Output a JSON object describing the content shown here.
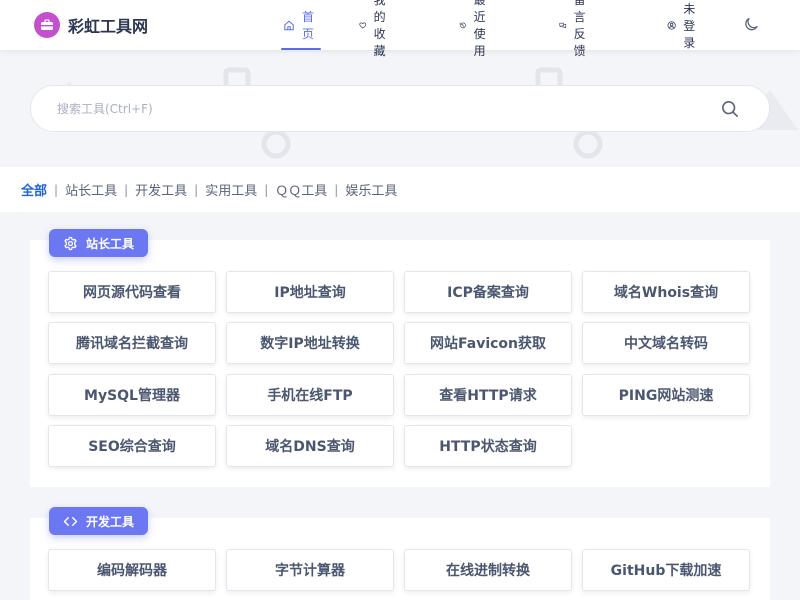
{
  "header": {
    "site_title": "彩虹工具网",
    "nav": [
      {
        "label": "首页",
        "icon": "home-icon"
      },
      {
        "label": "我的收藏",
        "icon": "heart-icon"
      },
      {
        "label": "最近使用",
        "icon": "history-icon"
      },
      {
        "label": "留言反馈",
        "icon": "chat-icon"
      },
      {
        "label": "未登录",
        "icon": "user-icon"
      }
    ],
    "theme_toggle_icon": "moon-icon"
  },
  "search": {
    "placeholder": "搜索工具(Ctrl+F)",
    "value": ""
  },
  "categories": [
    "全部",
    "站长工具",
    "开发工具",
    "实用工具",
    "ＱＱ工具",
    "娱乐工具"
  ],
  "sections": [
    {
      "title": "站长工具",
      "icon": "gear-icon",
      "tools": [
        "网页源代码查看",
        "IP地址查询",
        "ICP备案查询",
        "域名Whois查询",
        "腾讯域名拦截查询",
        "数字IP地址转换",
        "网站Favicon获取",
        "中文域名转码",
        "MySQL管理器",
        "手机在线FTP",
        "查看HTTP请求",
        "PING网站测速",
        "SEO综合查询",
        "域名DNS查询",
        "HTTP状态查询"
      ]
    },
    {
      "title": "开发工具",
      "icon": "code-icon",
      "tools": [
        "编码解码器",
        "字节计算器",
        "在线进制转换",
        "GitHub下载加速"
      ]
    }
  ],
  "colors": {
    "accent": "#5b6cf0",
    "badge": "#6c78f2",
    "active_category": "#1f63d6",
    "logo": "#c44fcf"
  }
}
